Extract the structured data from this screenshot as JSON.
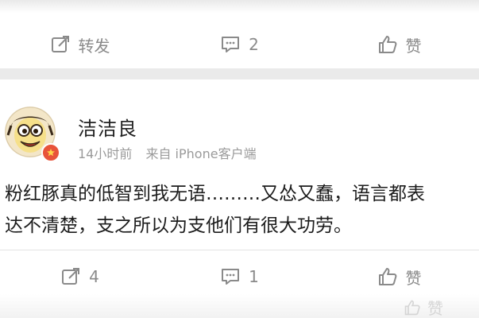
{
  "top_post": {
    "actions": {
      "repost_label": "转发",
      "comment_count": "2",
      "like_label": "赞"
    }
  },
  "main_post": {
    "username": "洁洁良",
    "time": "14小时前",
    "source": "来自 iPhone客户端",
    "text": "粉红豚真的低智到我无语………又怂又蠢，语言都表\n达不清楚，支之所以为支他们有很大功劳。",
    "actions": {
      "repost_count": "4",
      "comment_count": "1",
      "like_label": "赞"
    }
  },
  "ghost_like_label": "赞",
  "icons": [
    "repost-icon",
    "comment-icon",
    "like-icon",
    "vip-badge-icon"
  ],
  "colors": {
    "action_gray": "#8a8a8a",
    "badge_red": "#e8533a"
  }
}
